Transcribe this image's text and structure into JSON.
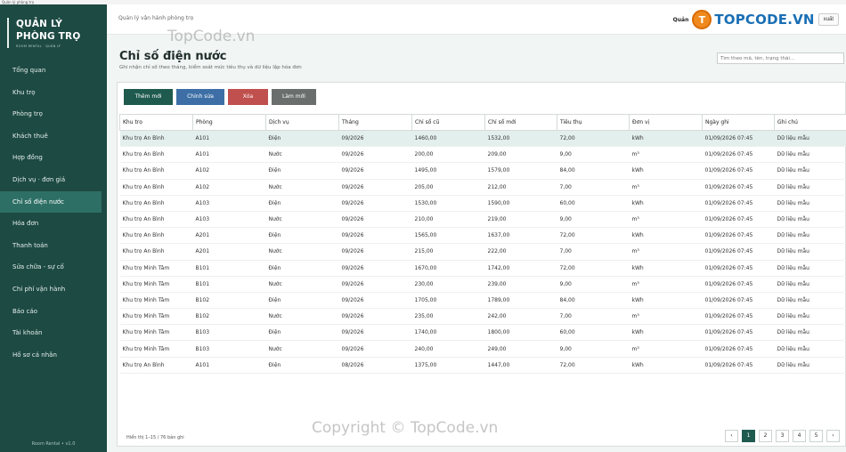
{
  "window": {
    "title": "Quản lý phòng trọ"
  },
  "sidebar": {
    "brand_title": "QUẢN LÝ\nPHÒNG TRỌ",
    "brand_sub": "ROOM RENTAL · QUẢN LÝ",
    "items": [
      {
        "label": "Tổng quan"
      },
      {
        "label": "Khu trọ"
      },
      {
        "label": "Phòng trọ"
      },
      {
        "label": "Khách thuê"
      },
      {
        "label": "Hợp đồng"
      },
      {
        "label": "Dịch vụ · đơn giá"
      },
      {
        "label": "Chỉ số điện nước",
        "active": true
      },
      {
        "label": "Hóa đơn"
      },
      {
        "label": "Thanh toán"
      },
      {
        "label": "Sửa chữa - sự cố"
      },
      {
        "label": "Chi phí vận hành"
      },
      {
        "label": "Báo cáo"
      },
      {
        "label": "Tài khoản"
      },
      {
        "label": "Hồ sơ cá nhân"
      }
    ],
    "footer": "Room Rental • v1.0"
  },
  "topbar": {
    "breadcrumb": "Quản lý vận hành phòng trọ",
    "user_label": "Quản",
    "logo_icon": "T",
    "logo_text": "TOPCODE.VN",
    "logout_label": "xuất"
  },
  "page": {
    "title": "Chỉ số điện nước",
    "subtitle": "Ghi nhận chỉ số theo tháng, kiểm soát mức tiêu thụ và dữ liệu lập hóa đơn",
    "search_placeholder": "Tìm theo mã, tên, trạng thái..."
  },
  "toolbar": {
    "add_label": "Thêm mới",
    "edit_label": "Chỉnh sửa",
    "delete_label": "Xóa",
    "refresh_label": "Làm mới"
  },
  "table": {
    "columns": [
      "Khu trọ",
      "Phòng",
      "Dịch vụ",
      "Tháng",
      "Chỉ số cũ",
      "Chỉ số mới",
      "Tiêu thụ",
      "Đơn vị",
      "Ngày ghi",
      "Ghi chú"
    ],
    "rows": [
      [
        "Khu trọ An Bình",
        "A101",
        "Điện",
        "09/2026",
        "1460,00",
        "1532,00",
        "72,00",
        "kWh",
        "01/09/2026 07:45",
        "Dữ liệu mẫu"
      ],
      [
        "Khu trọ An Bình",
        "A101",
        "Nước",
        "09/2026",
        "200,00",
        "209,00",
        "9,00",
        "m³",
        "01/09/2026 07:45",
        "Dữ liệu mẫu"
      ],
      [
        "Khu trọ An Bình",
        "A102",
        "Điện",
        "09/2026",
        "1495,00",
        "1579,00",
        "84,00",
        "kWh",
        "01/09/2026 07:45",
        "Dữ liệu mẫu"
      ],
      [
        "Khu trọ An Bình",
        "A102",
        "Nước",
        "09/2026",
        "205,00",
        "212,00",
        "7,00",
        "m³",
        "01/09/2026 07:45",
        "Dữ liệu mẫu"
      ],
      [
        "Khu trọ An Bình",
        "A103",
        "Điện",
        "09/2026",
        "1530,00",
        "1590,00",
        "60,00",
        "kWh",
        "01/09/2026 07:45",
        "Dữ liệu mẫu"
      ],
      [
        "Khu trọ An Bình",
        "A103",
        "Nước",
        "09/2026",
        "210,00",
        "219,00",
        "9,00",
        "m³",
        "01/09/2026 07:45",
        "Dữ liệu mẫu"
      ],
      [
        "Khu trọ An Bình",
        "A201",
        "Điện",
        "09/2026",
        "1565,00",
        "1637,00",
        "72,00",
        "kWh",
        "01/09/2026 07:45",
        "Dữ liệu mẫu"
      ],
      [
        "Khu trọ An Bình",
        "A201",
        "Nước",
        "09/2026",
        "215,00",
        "222,00",
        "7,00",
        "m³",
        "01/09/2026 07:45",
        "Dữ liệu mẫu"
      ],
      [
        "Khu trọ Minh Tâm",
        "B101",
        "Điện",
        "09/2026",
        "1670,00",
        "1742,00",
        "72,00",
        "kWh",
        "01/09/2026 07:45",
        "Dữ liệu mẫu"
      ],
      [
        "Khu trọ Minh Tâm",
        "B101",
        "Nước",
        "09/2026",
        "230,00",
        "239,00",
        "9,00",
        "m³",
        "01/09/2026 07:45",
        "Dữ liệu mẫu"
      ],
      [
        "Khu trọ Minh Tâm",
        "B102",
        "Điện",
        "09/2026",
        "1705,00",
        "1789,00",
        "84,00",
        "kWh",
        "01/09/2026 07:45",
        "Dữ liệu mẫu"
      ],
      [
        "Khu trọ Minh Tâm",
        "B102",
        "Nước",
        "09/2026",
        "235,00",
        "242,00",
        "7,00",
        "m³",
        "01/09/2026 07:45",
        "Dữ liệu mẫu"
      ],
      [
        "Khu trọ Minh Tâm",
        "B103",
        "Điện",
        "09/2026",
        "1740,00",
        "1800,00",
        "60,00",
        "kWh",
        "01/09/2026 07:45",
        "Dữ liệu mẫu"
      ],
      [
        "Khu trọ Minh Tâm",
        "B103",
        "Nước",
        "09/2026",
        "240,00",
        "249,00",
        "9,00",
        "m³",
        "01/09/2026 07:45",
        "Dữ liệu mẫu"
      ],
      [
        "Khu trọ An Bình",
        "A101",
        "Điện",
        "08/2026",
        "1375,00",
        "1447,00",
        "72,00",
        "kWh",
        "01/09/2026 07:45",
        "Dữ liệu mẫu"
      ]
    ]
  },
  "pager": {
    "info": "Hiển thị 1–15 / 76 bản ghi",
    "prev": "‹",
    "pages": [
      "1",
      "2",
      "3",
      "4",
      "5"
    ],
    "next": "›"
  },
  "watermarks": [
    "TopCode.vn",
    "Copyright © TopCode.vn"
  ],
  "colors": {
    "sidebar": "#1d4a43",
    "accent": "#1f5a4f",
    "edit": "#3d6fa6",
    "delete": "#c0504d"
  }
}
